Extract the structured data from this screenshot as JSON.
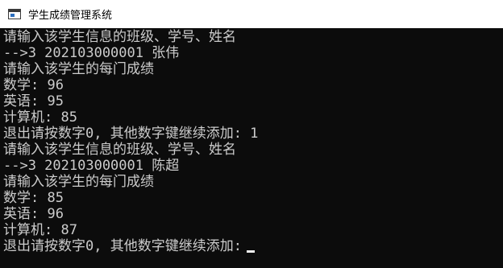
{
  "window": {
    "title": "学生成绩管理系统"
  },
  "console": {
    "lines": [
      "请输入该学生信息的班级、学号、姓名",
      "-->3 202103000001 张伟",
      "请输入该学生的每门成绩",
      "数学: 96",
      "英语: 95",
      "计算机: 85",
      "退出请按数字0, 其他数字键继续添加: 1",
      "请输入该学生信息的班级、学号、姓名",
      "-->3 202103000001 陈超",
      "请输入该学生的每门成绩",
      "数学: 85",
      "英语: 96",
      "计算机: 87",
      "退出请按数字0, 其他数字键继续添加:"
    ]
  }
}
